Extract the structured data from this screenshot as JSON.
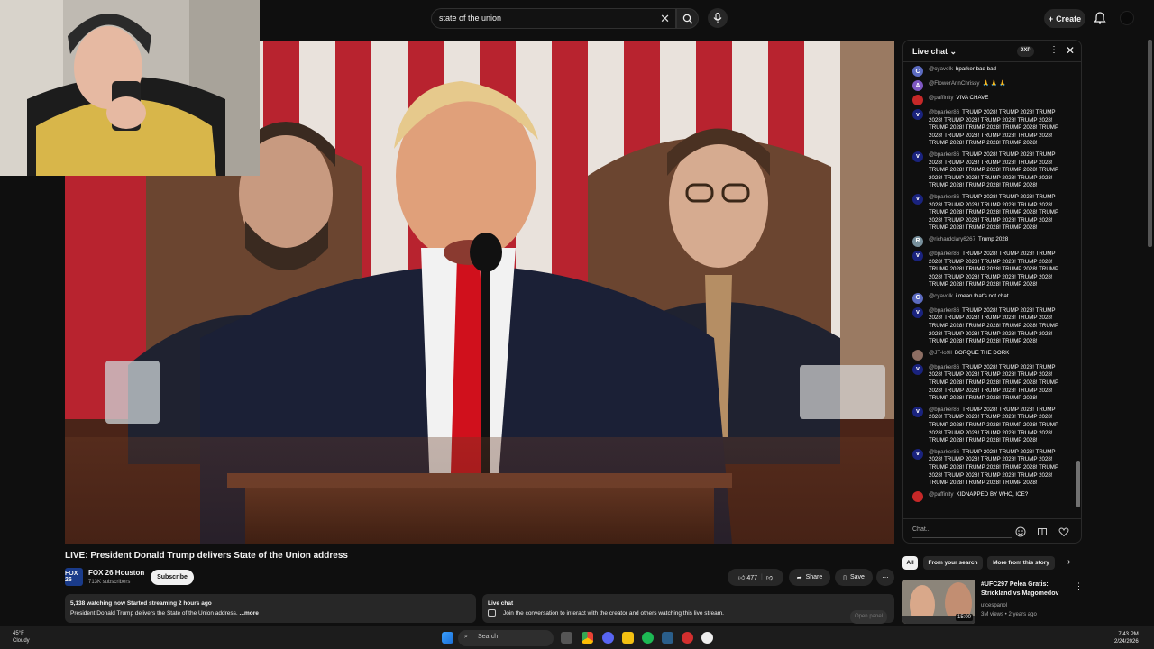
{
  "search": {
    "query": "state of the union"
  },
  "header": {
    "create_label": "Create"
  },
  "video": {
    "title": "LIVE: President Donald Trump delivers State of the Union address"
  },
  "channel": {
    "logo_text": "FOX 26",
    "name": "FOX 26 Houston",
    "subscribers": "713K subscribers",
    "subscribe_label": "Subscribe"
  },
  "actions": {
    "likes": "477",
    "share_label": "Share",
    "save_label": "Save"
  },
  "description": {
    "stats": "5,138 watching now  Started streaming 2 hours ago",
    "text": "President Donald Trump delivers the State of the Union address.",
    "more_label": "...more"
  },
  "livechat_box": {
    "title": "Live chat",
    "text": "Join the conversation to interact with the creator and others watching this live stream.",
    "open_panel_label": "Open panel"
  },
  "chat": {
    "title": "Live chat",
    "points": "0XP",
    "input_placeholder": "Chat...",
    "messages": [
      {
        "author": "@cyavolk",
        "text": "bparker bad bad",
        "avatar": "C",
        "color": "#5c6bc0"
      },
      {
        "author": "@FlowerAnnChrissy",
        "text": "🙏 🙏 🙏",
        "avatar": "A",
        "color": "#7e57c2"
      },
      {
        "author": "@paffinity",
        "text": "VIVA CHAVE",
        "avatar": "",
        "color": "#c62828"
      },
      {
        "author": "@bparker86",
        "text": "TRUMP 2028! TRUMP 2028! TRUMP 2028! TRUMP 2028! TRUMP 2028! TRUMP 2028! TRUMP 2028! TRUMP 2028! TRUMP 2028! TRUMP 2028! TRUMP 2028! TRUMP 2028! TRUMP 2028! TRUMP 2028! TRUMP 2028! TRUMP 2028!",
        "avatar": "v",
        "color": "#1a237e"
      },
      {
        "author": "@bparker86",
        "text": "TRUMP 2028! TRUMP 2028! TRUMP 2028! TRUMP 2028! TRUMP 2028! TRUMP 2028! TRUMP 2028! TRUMP 2028! TRUMP 2028! TRUMP 2028! TRUMP 2028! TRUMP 2028! TRUMP 2028! TRUMP 2028! TRUMP 2028! TRUMP 2028!",
        "avatar": "v",
        "color": "#1a237e"
      },
      {
        "author": "@bparker86",
        "text": "TRUMP 2028! TRUMP 2028! TRUMP 2028! TRUMP 2028! TRUMP 2028! TRUMP 2028! TRUMP 2028! TRUMP 2028! TRUMP 2028! TRUMP 2028! TRUMP 2028! TRUMP 2028! TRUMP 2028! TRUMP 2028! TRUMP 2028! TRUMP 2028!",
        "avatar": "v",
        "color": "#1a237e"
      },
      {
        "author": "@richardclary6267",
        "text": "Trump 2028",
        "avatar": "R",
        "color": "#78909c"
      },
      {
        "author": "@bparker86",
        "text": "TRUMP 2028! TRUMP 2028! TRUMP 2028! TRUMP 2028! TRUMP 2028! TRUMP 2028! TRUMP 2028! TRUMP 2028! TRUMP 2028! TRUMP 2028! TRUMP 2028! TRUMP 2028! TRUMP 2028! TRUMP 2028! TRUMP 2028! TRUMP 2028!",
        "avatar": "v",
        "color": "#1a237e"
      },
      {
        "author": "@cyavolk",
        "text": "i mean that's not chat",
        "avatar": "C",
        "color": "#5c6bc0"
      },
      {
        "author": "@bparker86",
        "text": "TRUMP 2028! TRUMP 2028! TRUMP 2028! TRUMP 2028! TRUMP 2028! TRUMP 2028! TRUMP 2028! TRUMP 2028! TRUMP 2028! TRUMP 2028! TRUMP 2028! TRUMP 2028! TRUMP 2028! TRUMP 2028! TRUMP 2028! TRUMP 2028!",
        "avatar": "v",
        "color": "#1a237e"
      },
      {
        "author": "@JT-lo9ll",
        "text": "BORQUE THE DORK",
        "avatar": "",
        "color": "#8d6e63"
      },
      {
        "author": "@bparker86",
        "text": "TRUMP 2028! TRUMP 2028! TRUMP 2028! TRUMP 2028! TRUMP 2028! TRUMP 2028! TRUMP 2028! TRUMP 2028! TRUMP 2028! TRUMP 2028! TRUMP 2028! TRUMP 2028! TRUMP 2028! TRUMP 2028! TRUMP 2028! TRUMP 2028!",
        "avatar": "v",
        "color": "#1a237e"
      },
      {
        "author": "@bparker86",
        "text": "TRUMP 2028! TRUMP 2028! TRUMP 2028! TRUMP 2028! TRUMP 2028! TRUMP 2028! TRUMP 2028! TRUMP 2028! TRUMP 2028! TRUMP 2028! TRUMP 2028! TRUMP 2028! TRUMP 2028! TRUMP 2028! TRUMP 2028! TRUMP 2028!",
        "avatar": "v",
        "color": "#1a237e"
      },
      {
        "author": "@bparker86",
        "text": "TRUMP 2028! TRUMP 2028! TRUMP 2028! TRUMP 2028! TRUMP 2028! TRUMP 2028! TRUMP 2028! TRUMP 2028! TRUMP 2028! TRUMP 2028! TRUMP 2028! TRUMP 2028! TRUMP 2028! TRUMP 2028! TRUMP 2028! TRUMP 2028!",
        "avatar": "v",
        "color": "#1a237e"
      },
      {
        "author": "@paffinity",
        "text": "KIDNAPPED BY WHO, ICE?",
        "avatar": "",
        "color": "#c62828"
      }
    ]
  },
  "chips": {
    "all": "All",
    "from_search": "From your search",
    "from_story": "More from this story"
  },
  "recommendation": {
    "title": "#UFC297 Pelea Gratis: Strickland vs Magomedov",
    "channel": "ufcespanol",
    "meta": "3M views • 2 years ago",
    "duration": "15:00"
  },
  "taskbar": {
    "temp": "45°F",
    "condition": "Cloudy",
    "search_label": "Search",
    "time": "7:43 PM",
    "date": "2/24/2026"
  }
}
